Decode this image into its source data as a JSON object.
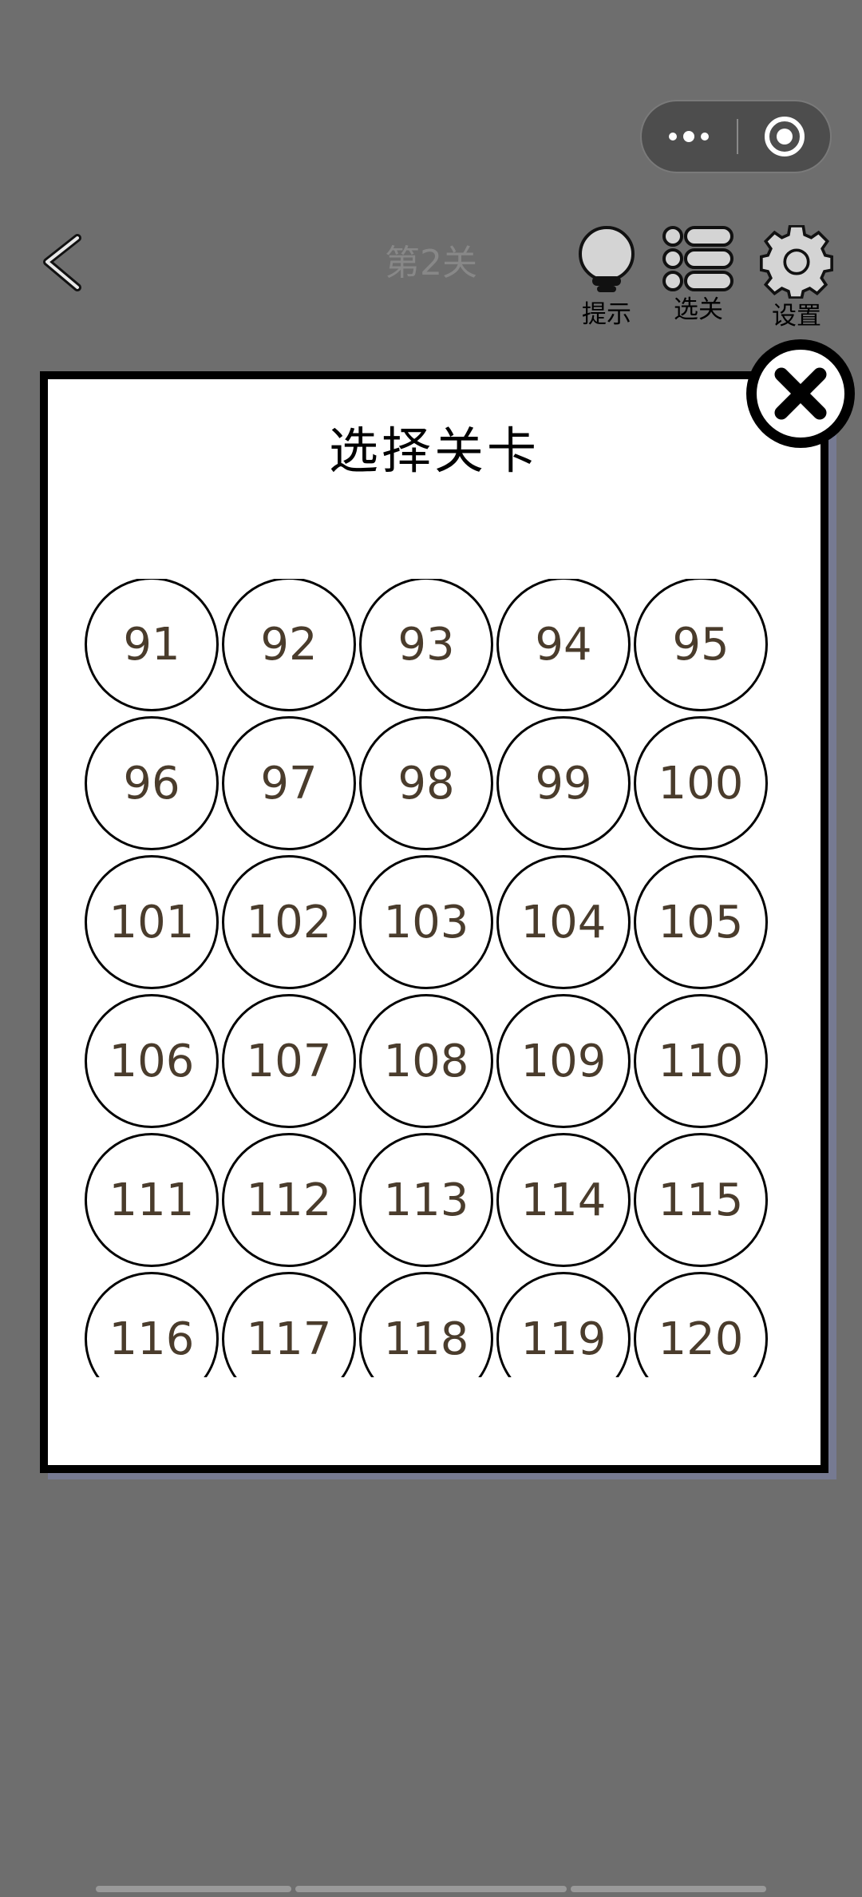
{
  "colors": {
    "background": "#6e6e6e",
    "modal_shadow": "#767a92",
    "number_text": "#4a3c2c"
  },
  "header": {
    "capsule": {
      "more_icon": "more-dots-icon",
      "close_icon": "record-circle-icon"
    },
    "back_icon": "chevron-left-icon",
    "level_title": "第2关",
    "tools": [
      {
        "label": "提示",
        "icon": "lightbulb-icon"
      },
      {
        "label": "选关",
        "icon": "level-list-icon"
      },
      {
        "label": "设置",
        "icon": "gear-icon"
      }
    ]
  },
  "modal": {
    "title": "选择关卡",
    "close_icon": "close-x-icon",
    "levels": [
      "91",
      "92",
      "93",
      "94",
      "95",
      "96",
      "97",
      "98",
      "99",
      "100",
      "101",
      "102",
      "103",
      "104",
      "105",
      "106",
      "107",
      "108",
      "109",
      "110",
      "111",
      "112",
      "113",
      "114",
      "115",
      "116",
      "117",
      "118",
      "119",
      "120"
    ]
  }
}
